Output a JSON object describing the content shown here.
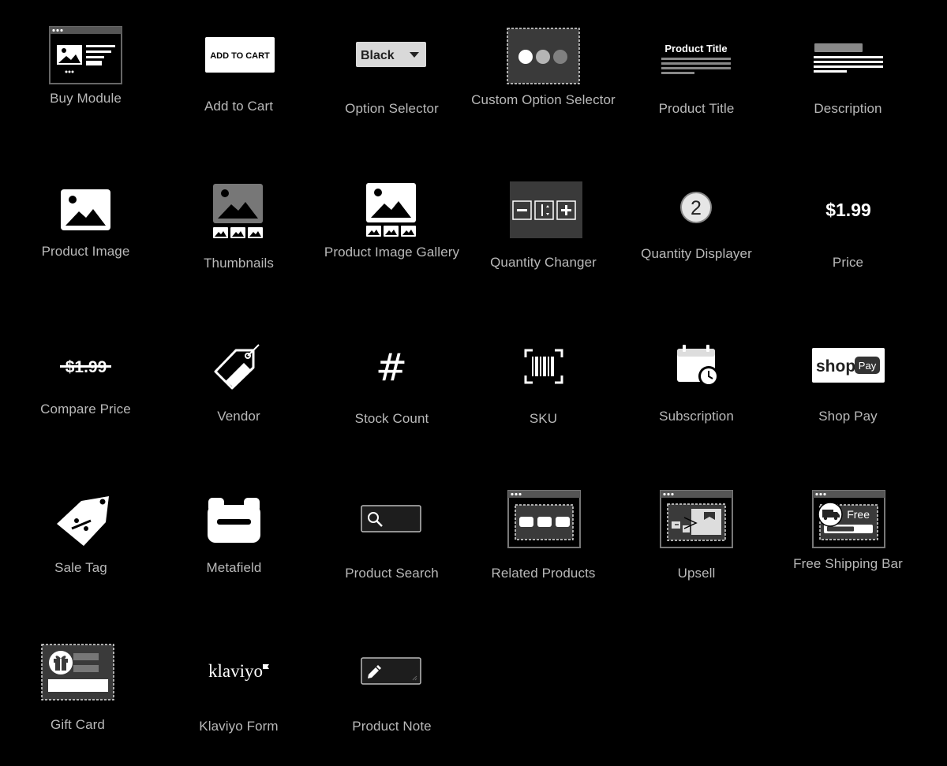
{
  "colors": {
    "background": "#000000",
    "label": "#b9b9b9",
    "icon": "#ffffff",
    "panel": "#3a3a3a"
  },
  "rows": [
    {
      "items": [
        {
          "key": "buy_module",
          "label": "Buy Module",
          "icon": "buy-module-icon"
        },
        {
          "key": "add_to_cart",
          "label": "Add to Cart",
          "icon": "add-to-cart-icon",
          "icon_text": "ADD TO CART"
        },
        {
          "key": "option_selector",
          "label": "Option Selector",
          "icon": "option-selector-icon",
          "icon_text": "Black"
        },
        {
          "key": "custom_option_selector",
          "label": "Custom Option Selector",
          "icon": "custom-option-selector-icon"
        },
        {
          "key": "product_title",
          "label": "Product Title",
          "icon": "product-title-icon",
          "icon_text": "Product Title"
        },
        {
          "key": "description",
          "label": "Description",
          "icon": "description-icon"
        }
      ]
    },
    {
      "items": [
        {
          "key": "product_image",
          "label": "Product Image",
          "icon": "product-image-icon"
        },
        {
          "key": "thumbnails",
          "label": "Thumbnails",
          "icon": "thumbnails-icon"
        },
        {
          "key": "product_image_gallery",
          "label": "Product Image Gallery",
          "icon": "product-image-gallery-icon"
        },
        {
          "key": "quantity_changer",
          "label": "Quantity Changer",
          "icon": "quantity-changer-icon"
        },
        {
          "key": "quantity_displayer",
          "label": "Quantity Displayer",
          "icon": "quantity-displayer-icon",
          "icon_text": "2"
        },
        {
          "key": "price",
          "label": "Price",
          "icon": "price-icon",
          "icon_text": "$1.99"
        }
      ]
    },
    {
      "items": [
        {
          "key": "compare_price",
          "label": "Compare Price",
          "icon": "compare-price-icon",
          "icon_text": "$1.99"
        },
        {
          "key": "vendor",
          "label": "Vendor",
          "icon": "vendor-tag-icon"
        },
        {
          "key": "stock_count",
          "label": "Stock Count",
          "icon": "hash-icon",
          "icon_text": "#"
        },
        {
          "key": "sku",
          "label": "SKU",
          "icon": "barcode-icon"
        },
        {
          "key": "subscription",
          "label": "Subscription",
          "icon": "calendar-clock-icon"
        },
        {
          "key": "shop_pay",
          "label": "Shop Pay",
          "icon": "shop-pay-icon",
          "icon_text": "shop",
          "icon_badge": "Pay"
        }
      ]
    },
    {
      "items": [
        {
          "key": "sale_tag",
          "label": "Sale Tag",
          "icon": "sale-tag-icon"
        },
        {
          "key": "metafield",
          "label": "Metafield",
          "icon": "metafield-icon"
        },
        {
          "key": "product_search",
          "label": "Product Search",
          "icon": "search-icon"
        },
        {
          "key": "related_products",
          "label": "Related Products",
          "icon": "related-products-icon"
        },
        {
          "key": "upsell",
          "label": "Upsell",
          "icon": "upsell-icon"
        },
        {
          "key": "free_shipping_bar",
          "label": "Free Shipping Bar",
          "icon": "free-shipping-bar-icon",
          "icon_text": "Free"
        }
      ]
    },
    {
      "items": [
        {
          "key": "gift_card",
          "label": "Gift Card",
          "icon": "gift-card-icon"
        },
        {
          "key": "klaviyo_form",
          "label": "Klaviyo Form",
          "icon": "klaviyo-logo-icon",
          "icon_text": "klaviyo"
        },
        {
          "key": "product_note",
          "label": "Product Note",
          "icon": "pencil-note-icon"
        }
      ]
    }
  ]
}
